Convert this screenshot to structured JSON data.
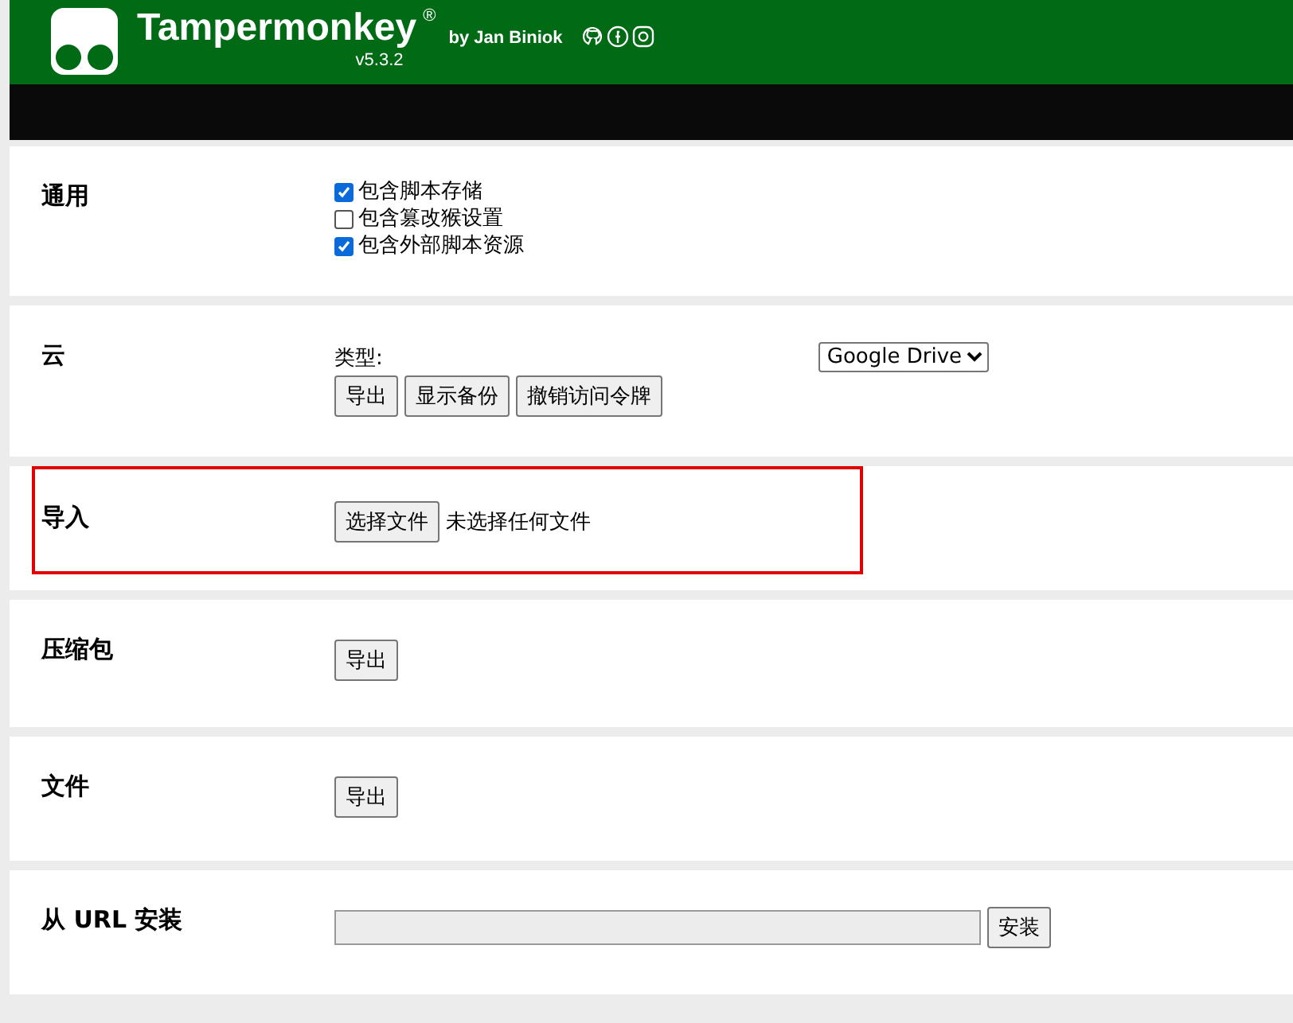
{
  "header": {
    "title": "Tampermonkey",
    "trademark": "®",
    "author": "by Jan Biniok",
    "version": "v5.3.2"
  },
  "sections": [
    {
      "kind": "checkboxes",
      "label": "通用",
      "highlighted": false,
      "items": [
        {
          "label": "包含脚本存储",
          "checked": true
        },
        {
          "label": "包含篡改猴设置",
          "checked": false
        },
        {
          "label": "包含外部脚本资源",
          "checked": true
        }
      ]
    },
    {
      "kind": "cloud",
      "label": "云",
      "highlighted": false,
      "type_label": "类型:",
      "select": "Google Drive",
      "buttons": [
        "导出",
        "显示备份",
        "撤销访问令牌"
      ]
    },
    {
      "kind": "file",
      "label": "导入",
      "highlighted": true,
      "button": "选择文件",
      "status": "未选择任何文件"
    },
    {
      "kind": "buttons",
      "label": "压缩包",
      "highlighted": false,
      "buttons": [
        "导出"
      ]
    },
    {
      "kind": "buttons",
      "label": "文件",
      "highlighted": false,
      "buttons": [
        "导出"
      ]
    },
    {
      "kind": "url",
      "label": "从 URL 安装",
      "highlighted": false,
      "button": "安装"
    }
  ]
}
